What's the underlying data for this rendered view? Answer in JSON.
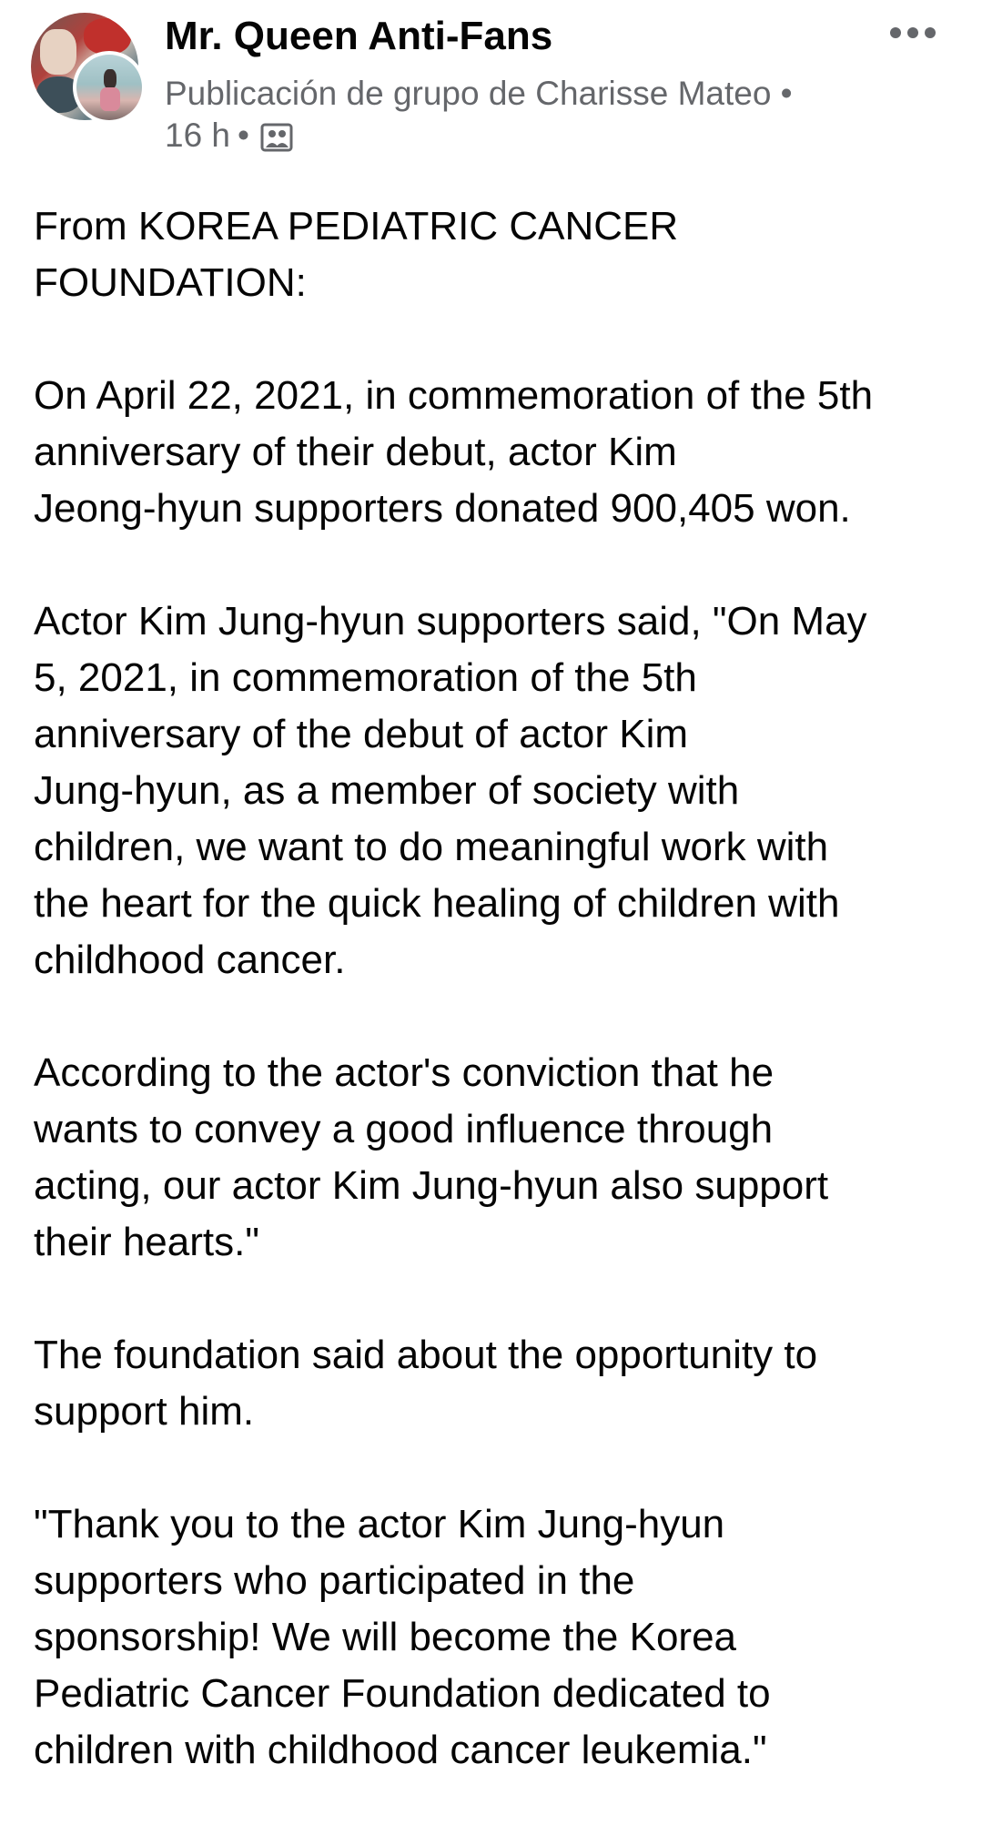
{
  "post": {
    "group_name": "Mr. Queen Anti-Fans",
    "meta_line": "Publicación de grupo de Charisse Mateo •",
    "time": "16 h",
    "separator": "•",
    "audience_icon": "group-audience-icon",
    "more_icon": "more-options-icon",
    "paragraphs": [
      "From KOREA PEDIATRIC CANCER\nFOUNDATION:",
      "On April 22, 2021, in commemoration of the 5th\nanniversary of their debut, actor Kim\nJeong-hyun supporters donated 900,405 won.",
      "Actor Kim Jung-hyun supporters said, \"On May\n5, 2021, in commemoration of the 5th\nanniversary of the debut of actor Kim\nJung-hyun, as a member of society with\nchildren, we want to do meaningful work with\nthe heart for the quick healing of children with\nchildhood cancer.",
      "According to the actor's conviction that he\nwants to convey a good influence through\nacting, our actor Kim Jung-hyun also support\ntheir hearts.\"",
      "The foundation said about the opportunity to\nsupport him.",
      "\"Thank you to the actor Kim Jung-hyun\nsupporters who participated in the\nsponsorship! We will become the Korea\nPediatric Cancer Foundation dedicated to\nchildren with childhood cancer leukemia.\""
    ]
  },
  "colors": {
    "primary_text": "#050505",
    "secondary_text": "#65676b",
    "background": "#ffffff"
  }
}
